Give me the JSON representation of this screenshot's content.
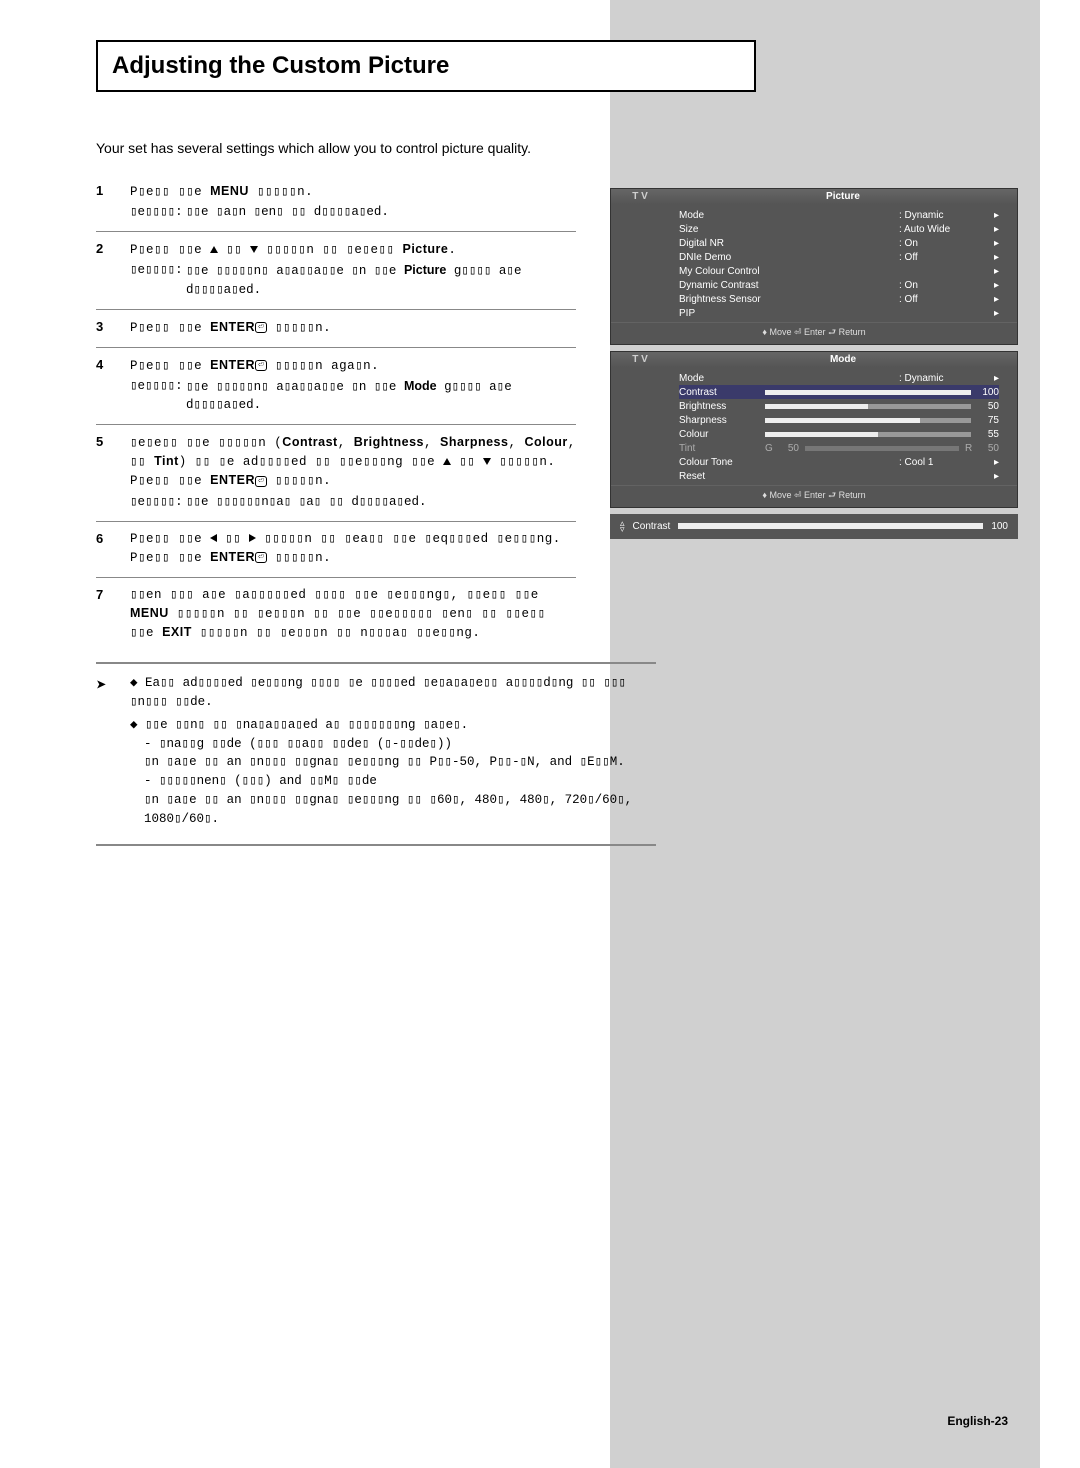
{
  "title": "Adjusting the Custom Picture",
  "intro": "Your set has several settings which allow you to control picture quality.",
  "steps": [
    {
      "num": "1",
      "line": "P▯e▯▯ ▯▯e MENU ▯▯▯▯▯n.",
      "result": "▯▯e ▯a▯n ▯en▯ ▯▯ d▯▯▯▯a▯ed."
    },
    {
      "num": "2",
      "line": "P▯e▯▯ ▯▯e ▲ ▯▯ ▼ ▯▯▯▯▯n ▯▯ ▯e▯e▯▯ Picture.",
      "result": "▯▯e ▯▯▯▯▯n▯ a▯a▯▯a▯▯e ▯n ▯▯e Picture g▯▯▯▯ a▯e d▯▯▯▯a▯ed."
    },
    {
      "num": "3",
      "line": "P▯e▯▯ ▯▯e ENTER ▯▯▯▯▯n."
    },
    {
      "num": "4",
      "line": "P▯e▯▯ ▯▯e ENTER ▯▯▯▯▯n aga▯n.",
      "result": "▯▯e ▯▯▯▯▯n▯ a▯a▯▯a▯▯e ▯n ▯▯e Mode g▯▯▯▯ a▯e d▯▯▯▯a▯ed."
    },
    {
      "num": "5",
      "line": "▯e▯e▯▯ ▯▯e ▯▯▯▯▯n (Contrast, Brightness, Sharpness, Colour, ▯▯ Tint) ▯▯ ▯e ad▯▯▯▯ed ▯▯ ▯▯e▯▯▯ng ▯▯e ▲ ▯▯ ▼ ▯▯▯▯▯n. P▯e▯▯ ▯▯e ENTER ▯▯▯▯▯n.",
      "result": "▯▯e ▯▯▯▯▯▯n▯a▯ ▯a▯ ▯▯ d▯▯▯▯a▯ed."
    },
    {
      "num": "6",
      "line": "P▯e▯▯ ▯▯e ◀ ▯▯ ▶ ▯▯▯▯▯n ▯▯ ▯ea▯▯ ▯▯e ▯eq▯▯▯ed ▯e▯▯▯ng. P▯e▯▯ ▯▯e ENTER ▯▯▯▯▯n."
    },
    {
      "num": "7",
      "line": "▯▯en ▯▯▯ a▯e ▯a▯▯▯▯▯ed ▯▯▯▯ ▯▯e ▯e▯▯▯ng▯, ▯▯e▯▯ ▯▯e MENU ▯▯▯▯▯n ▯▯ ▯e▯▯▯n ▯▯ ▯▯e ▯▯e▯▯▯▯▯ ▯en▯ ▯▯ ▯▯e▯▯ ▯▯e EXIT ▯▯▯▯▯n ▯▯ ▯e▯▯▯n ▯▯ n▯▯▯a▯ ▯▯e▯▯ng."
    }
  ],
  "notes": [
    "Ea▯▯ ad▯▯▯▯ed ▯e▯▯▯ng ▯▯▯▯ ▯e ▯▯▯▯ed ▯e▯a▯a▯e▯▯ a▯▯▯▯d▯ng ▯▯ ▯▯▯ ▯n▯▯▯ ▯▯de.",
    "▯▯e ▯▯n▯ ▯▯ ▯na▯a▯▯a▯ed a▯ ▯▯▯▯▯▯▯ng ▯a▯e▯."
  ],
  "note_sub": [
    "- ▯na▯▯g ▯▯de (▯▯▯ ▯▯a▯▯ ▯▯de▯ (▯-▯▯de▯))",
    "  ▯n ▯a▯e ▯▯ an ▯n▯▯▯ ▯▯gna▯ ▯e▯▯▯ng ▯▯ P▯▯-50, P▯▯-▯N, and ▯E▯▯M.",
    "- ▯▯▯▯▯nen▯ (▯▯▯) and ▯▯M▯ ▯▯de",
    "  ▯n ▯a▯e ▯▯ an ▯n▯▯▯ ▯▯gna▯ ▯e▯▯▯ng ▯▯ ▯60▯, 480▯, 480▯, 720▯/60▯, 1080▯/60▯."
  ],
  "osd1": {
    "title": "Picture",
    "tv": "T V",
    "rows": [
      {
        "k": "Mode",
        "v": ": Dynamic"
      },
      {
        "k": "Size",
        "v": ": Auto Wide"
      },
      {
        "k": "Digital NR",
        "v": ": On"
      },
      {
        "k": "DNIe Demo",
        "v": ": Off"
      },
      {
        "k": "My Colour Control",
        "v": ""
      },
      {
        "k": "Dynamic Contrast",
        "v": ": On"
      },
      {
        "k": "Brightness Sensor",
        "v": ": Off"
      },
      {
        "k": "PIP",
        "v": ""
      }
    ],
    "footer": "♦ Move    ⏎ Enter    ⮐ Return"
  },
  "osd2": {
    "title": "Mode",
    "tv": "T V",
    "mode_row": {
      "k": "Mode",
      "v": ": Dynamic"
    },
    "sliders": [
      {
        "k": "Contrast",
        "n": "100",
        "fill": 100,
        "hi": true
      },
      {
        "k": "Brightness",
        "n": "50",
        "fill": 50
      },
      {
        "k": "Sharpness",
        "n": "75",
        "fill": 75
      },
      {
        "k": "Colour",
        "n": "55",
        "fill": 55
      }
    ],
    "tint": {
      "k": "Tint",
      "g": "G",
      "gn": "50",
      "r": "R",
      "rn": "50"
    },
    "tone_row": {
      "k": "Colour Tone",
      "v": ": Cool 1"
    },
    "reset": "Reset",
    "footer": "♦ Move    ⏎ Enter    ⮐ Return"
  },
  "osd3": {
    "label": "Contrast",
    "value": "100"
  },
  "page_num": "English-23"
}
